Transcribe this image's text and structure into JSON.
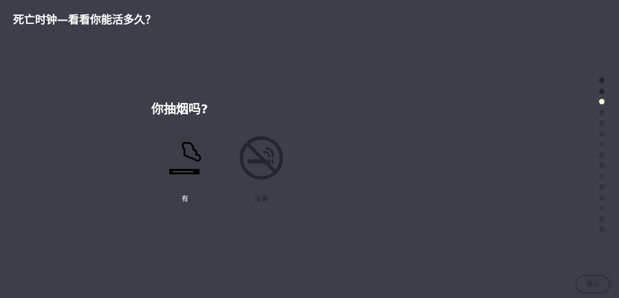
{
  "app": {
    "title": "死亡时钟—看看你能活多久？"
  },
  "question": {
    "text": "你抽烟吗?"
  },
  "options": [
    {
      "label": "有",
      "icon": "smoking-icon",
      "selected": true
    },
    {
      "label": "没有",
      "icon": "no-smoking-icon",
      "selected": false
    }
  ],
  "progress": {
    "total_steps": 15,
    "current_step": 3
  },
  "footer": {
    "confirm_label": "确认"
  },
  "colors": {
    "background": "#3c3e48",
    "text": "#ffffff",
    "muted": "#24262d",
    "current_dot": "#fdf6d8"
  }
}
